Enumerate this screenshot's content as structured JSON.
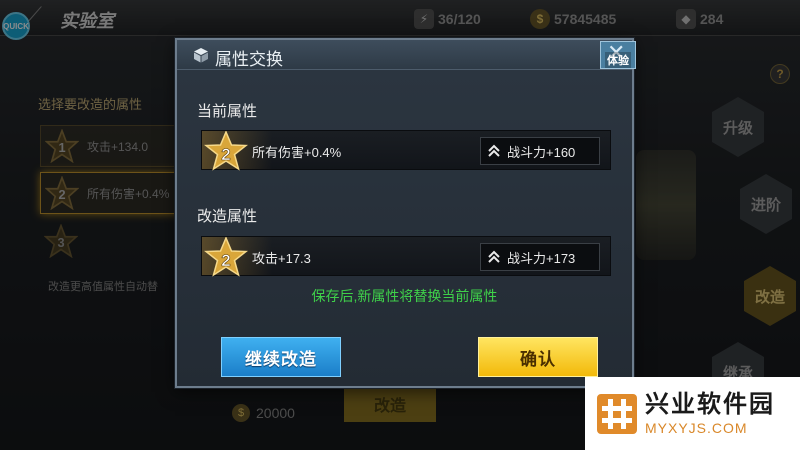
{
  "topbar": {
    "quick_label": "QUICK",
    "title": "实验室",
    "energy": "36/120",
    "gold": "57845485",
    "diamonds": "284"
  },
  "left_panel": {
    "title": "选择要改造的属性",
    "slots": [
      {
        "rank": "1",
        "text": "攻击+134.0"
      },
      {
        "rank": "2",
        "text": "所有伤害+0.4%"
      },
      {
        "rank": "3",
        "text": ""
      }
    ],
    "hint": "改造更高值属性自动替"
  },
  "bottom": {
    "cost": "20000",
    "modify_label": "改造"
  },
  "side_buttons": {
    "upgrade": "升级",
    "advance": "进阶",
    "modify": "改造",
    "inherit": "继承",
    "help": "?"
  },
  "dialog": {
    "title": "属性交换",
    "close_tag": "体验",
    "current_label": "当前属性",
    "current": {
      "rank": "2",
      "attr": "所有伤害+0.4%",
      "power": "战斗力+160"
    },
    "modified_label": "改造属性",
    "modified": {
      "rank": "2",
      "attr": "攻击+17.3",
      "power": "战斗力+173"
    },
    "notice": "保存后,新属性将替换当前属性",
    "continue_label": "继续改造",
    "confirm_label": "确认"
  },
  "watermark": {
    "name_cn": "兴业软件园",
    "name_en": "MYXYJS.COM"
  },
  "colors": {
    "notice_green": "#3fd04a",
    "confirm_yellow": "#f2b90a",
    "continue_blue": "#1b7ec8",
    "star_gold": "#d9a63a"
  }
}
